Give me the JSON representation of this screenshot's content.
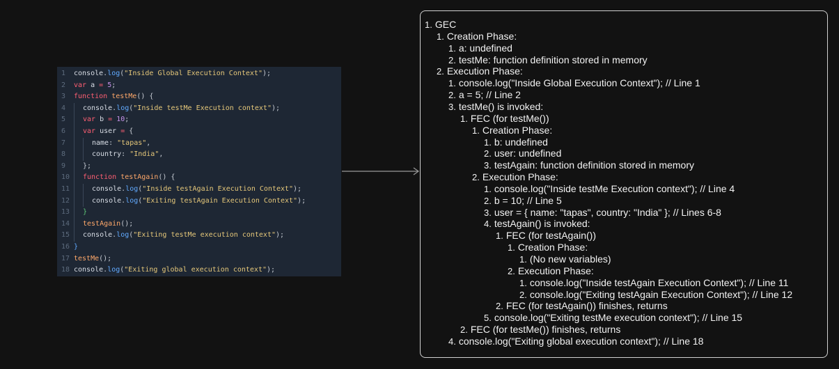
{
  "code": {
    "lines": [
      {
        "n": "1",
        "indent": 0,
        "tokens": [
          [
            "console",
            "var"
          ],
          [
            ".",
            "pun"
          ],
          [
            "log",
            "fn"
          ],
          [
            "(",
            "pun"
          ],
          [
            "\"Inside Global Execution Context\"",
            "str"
          ],
          [
            ");",
            "pun"
          ]
        ]
      },
      {
        "n": "2",
        "indent": 0,
        "tokens": [
          [
            "var ",
            "kw"
          ],
          [
            "a ",
            "var"
          ],
          [
            "= ",
            "kw"
          ],
          [
            "5",
            "num"
          ],
          [
            ";",
            "pun"
          ]
        ]
      },
      {
        "n": "3",
        "indent": 0,
        "tokens": [
          [
            "function ",
            "kw"
          ],
          [
            "testMe",
            "fname"
          ],
          [
            "() {",
            "pun"
          ]
        ]
      },
      {
        "n": "4",
        "indent": 1,
        "tokens": [
          [
            "console",
            "var"
          ],
          [
            ".",
            "pun"
          ],
          [
            "log",
            "fn"
          ],
          [
            "(",
            "pun"
          ],
          [
            "\"Inside testMe Execution context\"",
            "str"
          ],
          [
            ");",
            "pun"
          ]
        ]
      },
      {
        "n": "5",
        "indent": 1,
        "tokens": [
          [
            "var ",
            "kw"
          ],
          [
            "b ",
            "var"
          ],
          [
            "= ",
            "kw"
          ],
          [
            "10",
            "num"
          ],
          [
            ";",
            "pun"
          ]
        ]
      },
      {
        "n": "6",
        "indent": 1,
        "tokens": [
          [
            "var ",
            "kw"
          ],
          [
            "user ",
            "var"
          ],
          [
            "= ",
            "kw"
          ],
          [
            "{",
            "pun"
          ]
        ]
      },
      {
        "n": "7",
        "indent": 2,
        "tokens": [
          [
            "name",
            "prop"
          ],
          [
            ": ",
            "pun"
          ],
          [
            "\"tapas\"",
            "str"
          ],
          [
            ",",
            "pun"
          ]
        ]
      },
      {
        "n": "8",
        "indent": 2,
        "tokens": [
          [
            "country",
            "prop"
          ],
          [
            ": ",
            "pun"
          ],
          [
            "\"India\"",
            "str"
          ],
          [
            ",",
            "pun"
          ]
        ]
      },
      {
        "n": "9",
        "indent": 1,
        "tokens": [
          [
            "};",
            "pun"
          ]
        ]
      },
      {
        "n": "10",
        "indent": 1,
        "tokens": [
          [
            "function ",
            "kw"
          ],
          [
            "testAgain",
            "fname"
          ],
          [
            "() {",
            "pun"
          ]
        ]
      },
      {
        "n": "11",
        "indent": 2,
        "tokens": [
          [
            "console",
            "var"
          ],
          [
            ".",
            "pun"
          ],
          [
            "log",
            "fn"
          ],
          [
            "(",
            "pun"
          ],
          [
            "\"Inside testAgain Execution Context\"",
            "str"
          ],
          [
            ");",
            "pun"
          ]
        ]
      },
      {
        "n": "12",
        "indent": 2,
        "tokens": [
          [
            "console",
            "var"
          ],
          [
            ".",
            "pun"
          ],
          [
            "log",
            "fn"
          ],
          [
            "(",
            "pun"
          ],
          [
            "\"Exiting testAgain Execution Context\"",
            "str"
          ],
          [
            ");",
            "pun"
          ]
        ]
      },
      {
        "n": "13",
        "indent": 1,
        "tokens": [
          [
            "}",
            "br"
          ]
        ]
      },
      {
        "n": "14",
        "indent": 1,
        "tokens": [
          [
            "testAgain",
            "fname"
          ],
          [
            "();",
            "pun"
          ]
        ]
      },
      {
        "n": "15",
        "indent": 1,
        "tokens": [
          [
            "console",
            "var"
          ],
          [
            ".",
            "pun"
          ],
          [
            "log",
            "fn"
          ],
          [
            "(",
            "pun"
          ],
          [
            "\"Exiting testMe execution context\"",
            "str"
          ],
          [
            ");",
            "pun"
          ]
        ]
      },
      {
        "n": "16",
        "indent": 0,
        "tokens": [
          [
            "}",
            "fn"
          ]
        ]
      },
      {
        "n": "17",
        "indent": 0,
        "tokens": [
          [
            "testMe",
            "fname"
          ],
          [
            "();",
            "pun"
          ]
        ]
      },
      {
        "n": "18",
        "indent": 0,
        "tokens": [
          [
            "console",
            "var"
          ],
          [
            ".",
            "pun"
          ],
          [
            "log",
            "fn"
          ],
          [
            "(",
            "pun"
          ],
          [
            "\"Exiting global execution context\"",
            "str"
          ],
          [
            ");",
            "pun"
          ]
        ]
      }
    ]
  },
  "outline": [
    {
      "num": "1.",
      "text": "GEC",
      "level": 0
    },
    {
      "num": "1.",
      "text": "Creation Phase:",
      "level": 1
    },
    {
      "num": "1.",
      "text": "a: undefined",
      "level": 2
    },
    {
      "num": "2.",
      "text": "testMe: function definition stored in memory",
      "level": 2
    },
    {
      "num": "2.",
      "text": "Execution Phase:",
      "level": 1
    },
    {
      "num": "1.",
      "text": "console.log(\"Inside Global Execution Context\"); // Line 1",
      "level": 2
    },
    {
      "num": "2.",
      "text": "a = 5; // Line 2",
      "level": 2
    },
    {
      "num": "3.",
      "text": "testMe() is invoked:",
      "level": 2
    },
    {
      "num": "1.",
      "text": "FEC (for testMe())",
      "level": 3
    },
    {
      "num": "1.",
      "text": "Creation Phase:",
      "level": 4
    },
    {
      "num": "1.",
      "text": "b: undefined",
      "level": 5
    },
    {
      "num": "2.",
      "text": "user: undefined",
      "level": 5
    },
    {
      "num": "3.",
      "text": "testAgain: function definition stored in memory",
      "level": 5
    },
    {
      "num": "2.",
      "text": "Execution Phase:",
      "level": 4
    },
    {
      "num": "1.",
      "text": "console.log(\"Inside testMe Execution context\"); // Line 4",
      "level": 5
    },
    {
      "num": "2.",
      "text": "b = 10; // Line 5",
      "level": 5
    },
    {
      "num": "3.",
      "text": "user = { name: \"tapas\", country: \"India\" }; // Lines 6-8",
      "level": 5
    },
    {
      "num": "4.",
      "text": "testAgain() is invoked:",
      "level": 5
    },
    {
      "num": "1.",
      "text": "FEC (for testAgain())",
      "level": 6
    },
    {
      "num": "1.",
      "text": "Creation Phase:",
      "level": 7
    },
    {
      "num": "1.",
      "text": "(No new variables)",
      "level": 8
    },
    {
      "num": "2.",
      "text": "Execution Phase:",
      "level": 7
    },
    {
      "num": "1.",
      "text": "console.log(\"Inside testAgain Execution Context\"); // Line 11",
      "level": 8
    },
    {
      "num": "2.",
      "text": "console.log(\"Exiting testAgain Execution Context\"); // Line 12",
      "level": 8
    },
    {
      "num": "2.",
      "text": "FEC (for testAgain()) finishes, returns",
      "level": 6
    },
    {
      "num": "5.",
      "text": "console.log(\"Exiting testMe execution context\"); // Line 15",
      "level": 5
    },
    {
      "num": "2.",
      "text": "FEC (for testMe()) finishes, returns",
      "level": 3
    },
    {
      "num": "4.",
      "text": "console.log(\"Exiting global execution context\"); // Line 18",
      "level": 2
    }
  ]
}
